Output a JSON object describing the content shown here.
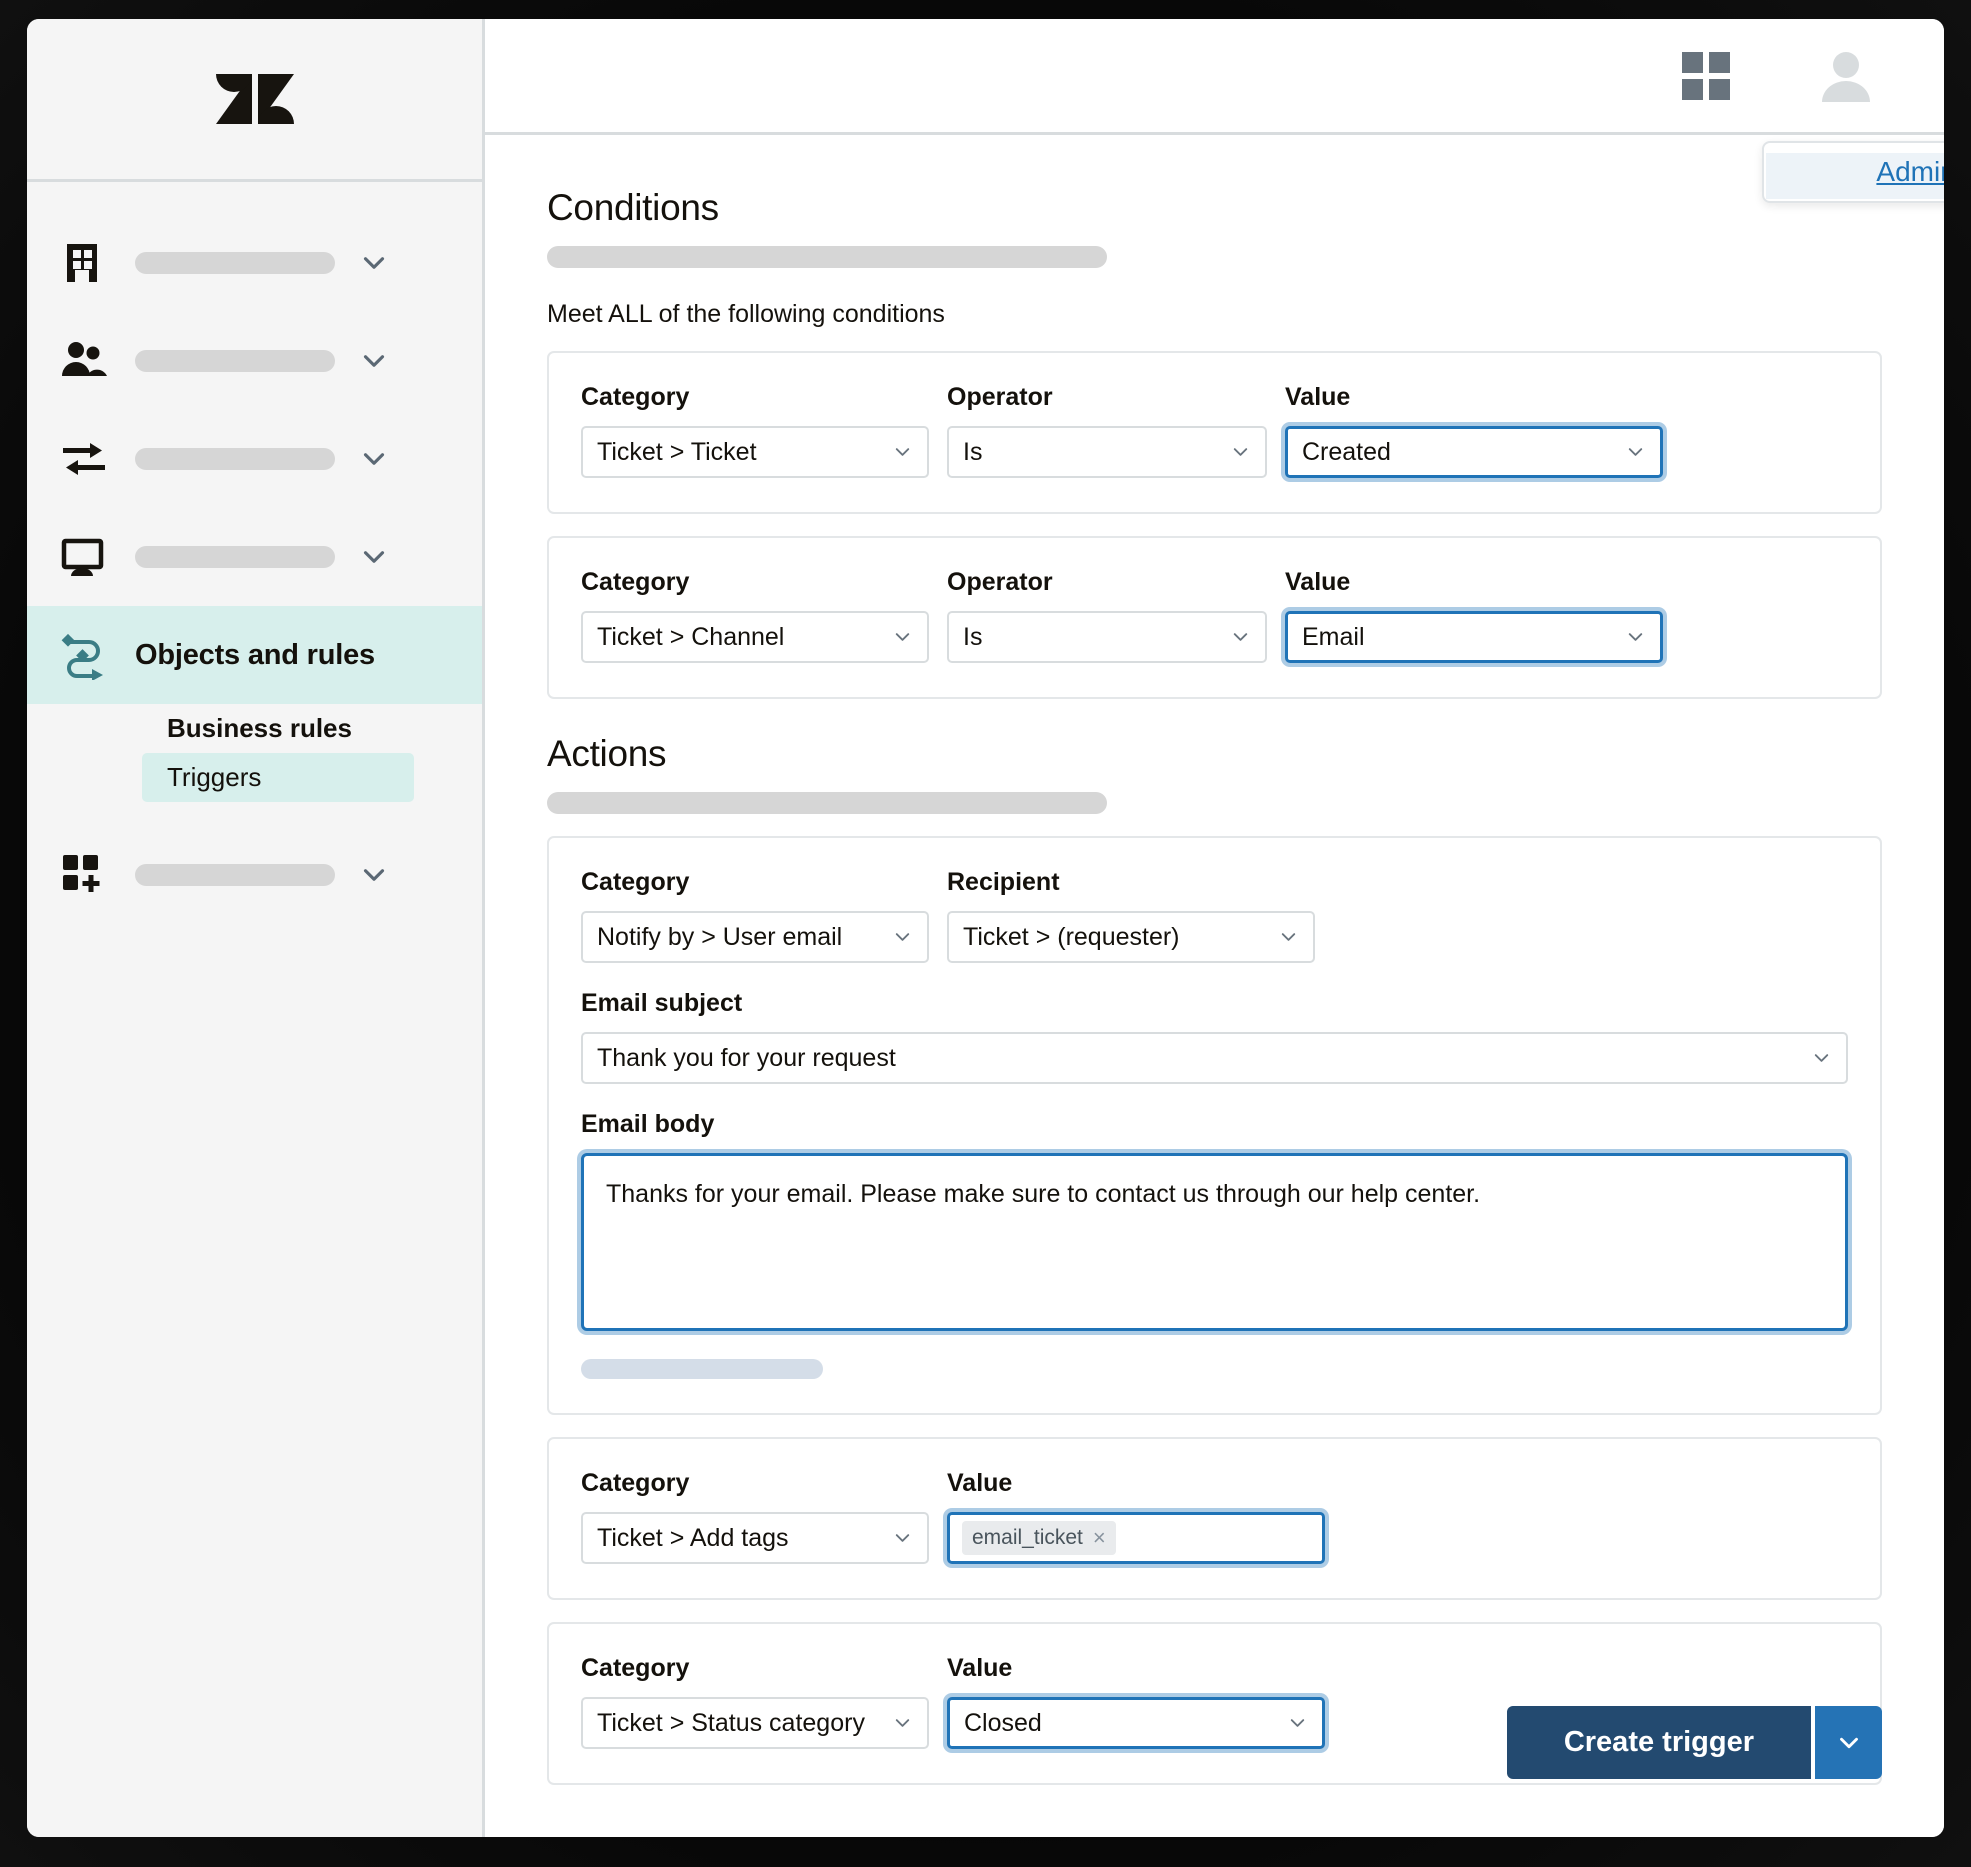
{
  "sidebar": {
    "logo_name": "zendesk-logo",
    "nav_items": [
      {
        "icon": "building-icon",
        "label": "",
        "skeleton": true,
        "expandable": true
      },
      {
        "icon": "people-icon",
        "label": "",
        "skeleton": true,
        "expandable": true
      },
      {
        "icon": "arrows-transfer-icon",
        "label": "",
        "skeleton": true,
        "expandable": true
      },
      {
        "icon": "monitor-icon",
        "label": "",
        "skeleton": true,
        "expandable": true
      },
      {
        "icon": "objects-rules-icon",
        "label": "Objects and rules",
        "skeleton": false,
        "expandable": false
      },
      {
        "icon": "apps-add-icon",
        "label": "",
        "skeleton": true,
        "expandable": true
      }
    ],
    "sub_items": [
      {
        "label": "Business rules",
        "heading": true,
        "selected": false
      },
      {
        "label": "Triggers",
        "heading": false,
        "selected": true
      }
    ]
  },
  "topbar": {
    "grid_icon": "grid-apps-icon",
    "avatar_icon": "user-avatar-icon",
    "admin_popover_link": "Admin Center"
  },
  "conditions": {
    "heading": "Conditions",
    "meet_all_label": "Meet ALL of the following conditions",
    "labels": {
      "category": "Category",
      "operator": "Operator",
      "value": "Value"
    },
    "rows": [
      {
        "category": "Ticket > Ticket",
        "operator": "Is",
        "value": "Created",
        "value_focused": true
      },
      {
        "category": "Ticket > Channel",
        "operator": "Is",
        "value": "Email",
        "value_focused": true
      }
    ]
  },
  "actions": {
    "heading": "Actions",
    "labels": {
      "category": "Category",
      "recipient": "Recipient",
      "value": "Value",
      "email_subject": "Email subject",
      "email_body": "Email body"
    },
    "notify_action": {
      "category": "Notify by > User email",
      "recipient": "Ticket > (requester)",
      "email_subject": "Thank you for your request",
      "email_body": "Thanks for your email. Please make sure to contact us through our help center."
    },
    "tag_action": {
      "category": "Ticket > Add tags",
      "tag": "email_ticket",
      "tag_remove": "×"
    },
    "status_action": {
      "category": "Ticket > Status category",
      "value": "Closed"
    }
  },
  "footer": {
    "create_label": "Create trigger",
    "caret_icon": "chevron-down-icon"
  },
  "colors": {
    "accent_teal": "#d7efec",
    "focus_blue": "#1f73b7",
    "focus_ring": "#adcce5",
    "primary_button": "#234a70",
    "caret_button": "#2573b5",
    "link": "#1f73b7",
    "border": "#d8dcde"
  }
}
